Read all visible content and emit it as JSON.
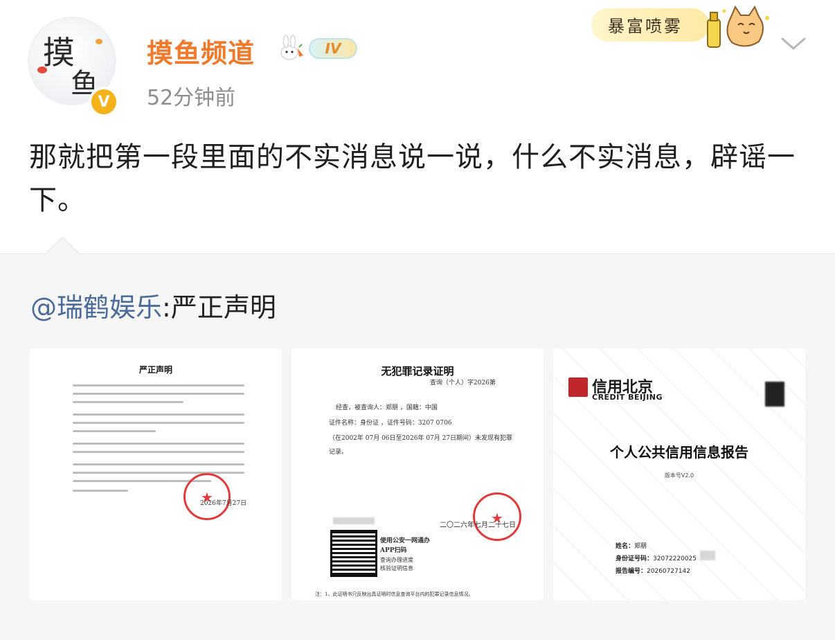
{
  "header": {
    "username": "摸鱼频道",
    "post_time": "52分钟前",
    "iv_badge": "IV",
    "verified_badge": "V",
    "avatar_text_top": "摸",
    "avatar_text_bottom": "鱼",
    "sticker_text": "暴富喷雾"
  },
  "post": {
    "text": "那就把第一段里面的不实消息说一说，什么不实消息，辟谣一下。"
  },
  "repost": {
    "mention": "@瑞鹤娱乐",
    "title_rest": ":严正声明",
    "images": [
      {
        "doc_title": "严正声明",
        "seal_date": "2026年7月27日"
      },
      {
        "doc_title": "无犯罪记录证明",
        "query_no": "查询（个人）字2026第",
        "line1": "经查，被查询人：郑朋            ，国籍：中国",
        "line2": "证件名称：身份证       ，证件号码：3207          0706",
        "line3": "（在2002年 07月 06日至2026年 07月 27日期间）未发现有犯罪",
        "line4": "记录。",
        "date_text": "二〇二六年七月二十七日",
        "app_line1": "使用公安一网通办",
        "app_line2": "APP扫码",
        "app_line3": "查询办理进度",
        "app_line4": "核验证明信息",
        "footnote": "注：1、此证明书只反映出具证明时信息查询平台内的犯罪记录信息情况。"
      },
      {
        "brand_cn": "信用北京",
        "brand_en": "CREDIT BEIJING",
        "report_title": "个人公共信用信息报告",
        "version": "版本号V2.0",
        "name_label": "姓名：",
        "name_value": "郑朋",
        "id_label": "身份证号码：",
        "id_value": "32072220025",
        "report_no_label": "报告编号：",
        "report_no_value": "20260727142"
      }
    ]
  },
  "colors": {
    "username": "#f07a2c",
    "mention": "#4a6a9a",
    "verified": "#f6b21b",
    "seal": "#e03a3a",
    "credit_red": "#c0272d"
  },
  "icons": [
    "avatar",
    "verified-v-icon",
    "bunny-icon",
    "iv-badge-icon",
    "sticker-cat-icon",
    "chevron-down-icon",
    "seal-star-icon",
    "qr-code-icon",
    "credit-logo-icon"
  ]
}
